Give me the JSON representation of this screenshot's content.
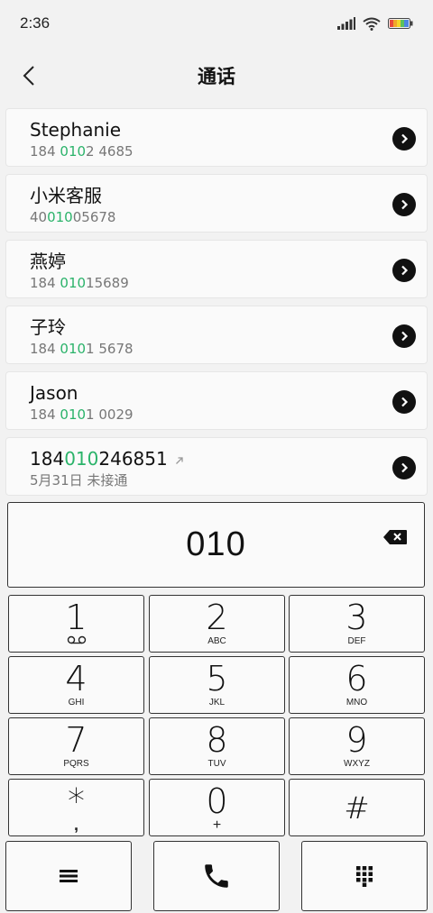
{
  "status_bar": {
    "time": "2:36"
  },
  "header": {
    "title": "通话"
  },
  "contacts": [
    {
      "name_parts": [
        "Stephanie"
      ],
      "sub_parts": [
        "184 ",
        "010",
        "2 4685"
      ]
    },
    {
      "name_parts": [
        "小米客服"
      ],
      "sub_parts": [
        "40",
        "010",
        "05678"
      ]
    },
    {
      "name_parts": [
        "燕婷"
      ],
      "sub_parts": [
        "184 ",
        "010",
        "15689"
      ]
    },
    {
      "name_parts": [
        "子玲"
      ],
      "sub_parts": [
        "184 ",
        "010",
        "1 5678"
      ]
    },
    {
      "name_parts": [
        "Jason"
      ],
      "sub_parts": [
        "184 ",
        "010",
        "1 0029"
      ]
    },
    {
      "name_parts": [
        "184",
        "010",
        "246851"
      ],
      "sub_parts": [
        "5月31日 未接通"
      ]
    }
  ],
  "dialer": {
    "number": "010"
  },
  "keypad": [
    {
      "digit": "1",
      "letters": ""
    },
    {
      "digit": "2",
      "letters": "ABC"
    },
    {
      "digit": "3",
      "letters": "DEF"
    },
    {
      "digit": "4",
      "letters": "GHI"
    },
    {
      "digit": "5",
      "letters": "JKL"
    },
    {
      "digit": "6",
      "letters": "MNO"
    },
    {
      "digit": "7",
      "letters": "PQRS"
    },
    {
      "digit": "8",
      "letters": "TUV"
    },
    {
      "digit": "9",
      "letters": "WXYZ"
    },
    {
      "digit": "*",
      "letters": ","
    },
    {
      "digit": "0",
      "letters": "+"
    },
    {
      "digit": "#",
      "letters": ""
    }
  ],
  "colors": {
    "highlight": "#2bb36a",
    "border": "#333333",
    "background": "#f2f2f2"
  },
  "icons": {
    "back": "chevron-left-icon",
    "detail": "chevron-right-circle-icon",
    "backspace": "backspace-icon",
    "voicemail": "voicemail-icon",
    "menu": "menu-icon",
    "call": "phone-icon",
    "dialpad": "dialpad-icon",
    "outgoing": "outgoing-arrow-icon"
  }
}
